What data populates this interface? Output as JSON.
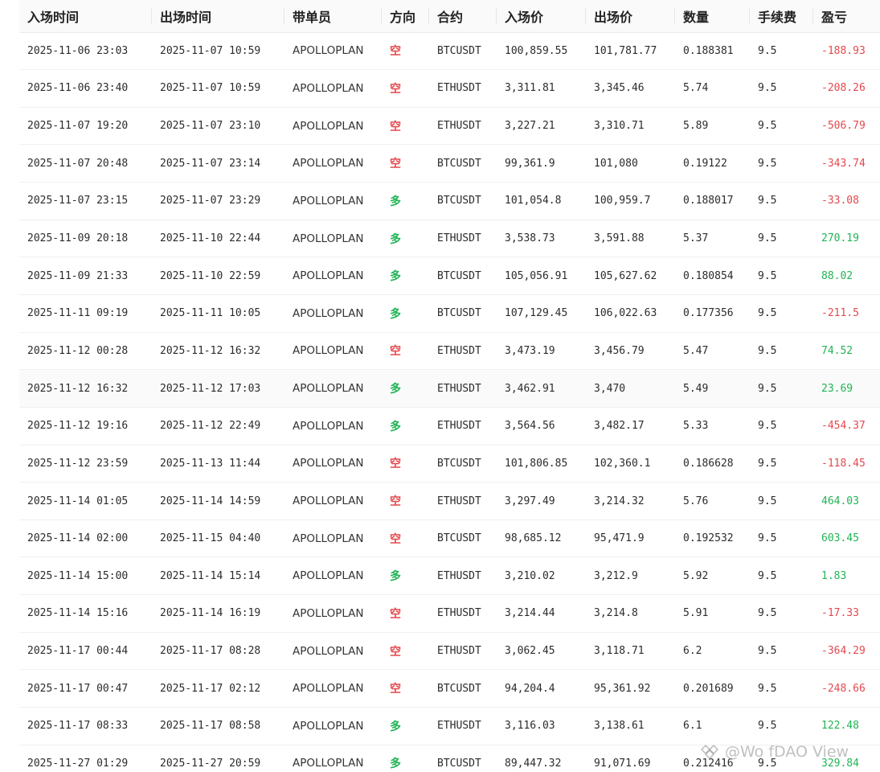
{
  "columns": [
    "入场时间",
    "出场时间",
    "带单员",
    "方向",
    "合约",
    "入场价",
    "出场价",
    "数量",
    "手续费",
    "盈亏"
  ],
  "colors": {
    "short": "#e5484d",
    "long": "#21b455",
    "loss": "#e5484d",
    "profit": "#21b455"
  },
  "rows": [
    {
      "entry_time": "2025-11-06 23:03",
      "exit_time": "2025-11-07 10:59",
      "trader": "APOLLOPLAN",
      "direction": "空",
      "side": "short",
      "contract": "BTCUSDT",
      "entry_price": "100,859.55",
      "exit_price": "101,781.77",
      "quantity": "0.188381",
      "fee": "9.5",
      "pnl": "-188.93",
      "pnl_sign": "neg"
    },
    {
      "entry_time": "2025-11-06 23:40",
      "exit_time": "2025-11-07 10:59",
      "trader": "APOLLOPLAN",
      "direction": "空",
      "side": "short",
      "contract": "ETHUSDT",
      "entry_price": "3,311.81",
      "exit_price": "3,345.46",
      "quantity": "5.74",
      "fee": "9.5",
      "pnl": "-208.26",
      "pnl_sign": "neg"
    },
    {
      "entry_time": "2025-11-07 19:20",
      "exit_time": "2025-11-07 23:10",
      "trader": "APOLLOPLAN",
      "direction": "空",
      "side": "short",
      "contract": "ETHUSDT",
      "entry_price": "3,227.21",
      "exit_price": "3,310.71",
      "quantity": "5.89",
      "fee": "9.5",
      "pnl": "-506.79",
      "pnl_sign": "neg"
    },
    {
      "entry_time": "2025-11-07 20:48",
      "exit_time": "2025-11-07 23:14",
      "trader": "APOLLOPLAN",
      "direction": "空",
      "side": "short",
      "contract": "BTCUSDT",
      "entry_price": "99,361.9",
      "exit_price": "101,080",
      "quantity": "0.19122",
      "fee": "9.5",
      "pnl": "-343.74",
      "pnl_sign": "neg"
    },
    {
      "entry_time": "2025-11-07 23:15",
      "exit_time": "2025-11-07 23:29",
      "trader": "APOLLOPLAN",
      "direction": "多",
      "side": "long",
      "contract": "BTCUSDT",
      "entry_price": "101,054.8",
      "exit_price": "100,959.7",
      "quantity": "0.188017",
      "fee": "9.5",
      "pnl": "-33.08",
      "pnl_sign": "neg"
    },
    {
      "entry_time": "2025-11-09 20:18",
      "exit_time": "2025-11-10 22:44",
      "trader": "APOLLOPLAN",
      "direction": "多",
      "side": "long",
      "contract": "ETHUSDT",
      "entry_price": "3,538.73",
      "exit_price": "3,591.88",
      "quantity": "5.37",
      "fee": "9.5",
      "pnl": "270.19",
      "pnl_sign": "pos"
    },
    {
      "entry_time": "2025-11-09 21:33",
      "exit_time": "2025-11-10 22:59",
      "trader": "APOLLOPLAN",
      "direction": "多",
      "side": "long",
      "contract": "BTCUSDT",
      "entry_price": "105,056.91",
      "exit_price": "105,627.62",
      "quantity": "0.180854",
      "fee": "9.5",
      "pnl": "88.02",
      "pnl_sign": "pos"
    },
    {
      "entry_time": "2025-11-11 09:19",
      "exit_time": "2025-11-11 10:05",
      "trader": "APOLLOPLAN",
      "direction": "多",
      "side": "long",
      "contract": "BTCUSDT",
      "entry_price": "107,129.45",
      "exit_price": "106,022.63",
      "quantity": "0.177356",
      "fee": "9.5",
      "pnl": "-211.5",
      "pnl_sign": "neg"
    },
    {
      "entry_time": "2025-11-12 00:28",
      "exit_time": "2025-11-12 16:32",
      "trader": "APOLLOPLAN",
      "direction": "空",
      "side": "short",
      "contract": "ETHUSDT",
      "entry_price": "3,473.19",
      "exit_price": "3,456.79",
      "quantity": "5.47",
      "fee": "9.5",
      "pnl": "74.52",
      "pnl_sign": "pos"
    },
    {
      "entry_time": "2025-11-12 16:32",
      "exit_time": "2025-11-12 17:03",
      "trader": "APOLLOPLAN",
      "direction": "多",
      "side": "long",
      "contract": "ETHUSDT",
      "entry_price": "3,462.91",
      "exit_price": "3,470",
      "quantity": "5.49",
      "fee": "9.5",
      "pnl": "23.69",
      "pnl_sign": "pos"
    },
    {
      "entry_time": "2025-11-12 19:16",
      "exit_time": "2025-11-12 22:49",
      "trader": "APOLLOPLAN",
      "direction": "多",
      "side": "long",
      "contract": "ETHUSDT",
      "entry_price": "3,564.56",
      "exit_price": "3,482.17",
      "quantity": "5.33",
      "fee": "9.5",
      "pnl": "-454.37",
      "pnl_sign": "neg"
    },
    {
      "entry_time": "2025-11-12 23:59",
      "exit_time": "2025-11-13 11:44",
      "trader": "APOLLOPLAN",
      "direction": "空",
      "side": "short",
      "contract": "BTCUSDT",
      "entry_price": "101,806.85",
      "exit_price": "102,360.1",
      "quantity": "0.186628",
      "fee": "9.5",
      "pnl": "-118.45",
      "pnl_sign": "neg"
    },
    {
      "entry_time": "2025-11-14 01:05",
      "exit_time": "2025-11-14 14:59",
      "trader": "APOLLOPLAN",
      "direction": "空",
      "side": "short",
      "contract": "ETHUSDT",
      "entry_price": "3,297.49",
      "exit_price": "3,214.32",
      "quantity": "5.76",
      "fee": "9.5",
      "pnl": "464.03",
      "pnl_sign": "pos"
    },
    {
      "entry_time": "2025-11-14 02:00",
      "exit_time": "2025-11-15 04:40",
      "trader": "APOLLOPLAN",
      "direction": "空",
      "side": "short",
      "contract": "BTCUSDT",
      "entry_price": "98,685.12",
      "exit_price": "95,471.9",
      "quantity": "0.192532",
      "fee": "9.5",
      "pnl": "603.45",
      "pnl_sign": "pos"
    },
    {
      "entry_time": "2025-11-14 15:00",
      "exit_time": "2025-11-14 15:14",
      "trader": "APOLLOPLAN",
      "direction": "多",
      "side": "long",
      "contract": "ETHUSDT",
      "entry_price": "3,210.02",
      "exit_price": "3,212.9",
      "quantity": "5.92",
      "fee": "9.5",
      "pnl": "1.83",
      "pnl_sign": "pos"
    },
    {
      "entry_time": "2025-11-14 15:16",
      "exit_time": "2025-11-14 16:19",
      "trader": "APOLLOPLAN",
      "direction": "空",
      "side": "short",
      "contract": "ETHUSDT",
      "entry_price": "3,214.44",
      "exit_price": "3,214.8",
      "quantity": "5.91",
      "fee": "9.5",
      "pnl": "-17.33",
      "pnl_sign": "neg"
    },
    {
      "entry_time": "2025-11-17 00:44",
      "exit_time": "2025-11-17 08:28",
      "trader": "APOLLOPLAN",
      "direction": "空",
      "side": "short",
      "contract": "ETHUSDT",
      "entry_price": "3,062.45",
      "exit_price": "3,118.71",
      "quantity": "6.2",
      "fee": "9.5",
      "pnl": "-364.29",
      "pnl_sign": "neg"
    },
    {
      "entry_time": "2025-11-17 00:47",
      "exit_time": "2025-11-17 02:12",
      "trader": "APOLLOPLAN",
      "direction": "空",
      "side": "short",
      "contract": "BTCUSDT",
      "entry_price": "94,204.4",
      "exit_price": "95,361.92",
      "quantity": "0.201689",
      "fee": "9.5",
      "pnl": "-248.66",
      "pnl_sign": "neg"
    },
    {
      "entry_time": "2025-11-17 08:33",
      "exit_time": "2025-11-17 08:58",
      "trader": "APOLLOPLAN",
      "direction": "多",
      "side": "long",
      "contract": "ETHUSDT",
      "entry_price": "3,116.03",
      "exit_price": "3,138.61",
      "quantity": "6.1",
      "fee": "9.5",
      "pnl": "122.48",
      "pnl_sign": "pos"
    },
    {
      "entry_time": "2025-11-27 01:29",
      "exit_time": "2025-11-27 20:59",
      "trader": "APOLLOPLAN",
      "direction": "多",
      "side": "long",
      "contract": "BTCUSDT",
      "entry_price": "89,447.32",
      "exit_price": "91,071.69",
      "quantity": "0.212416",
      "fee": "9.5",
      "pnl": "329.84",
      "pnl_sign": "pos"
    }
  ],
  "watermark": {
    "text": "@Wo fDAO View",
    "icon": "watermark-logo-icon"
  }
}
